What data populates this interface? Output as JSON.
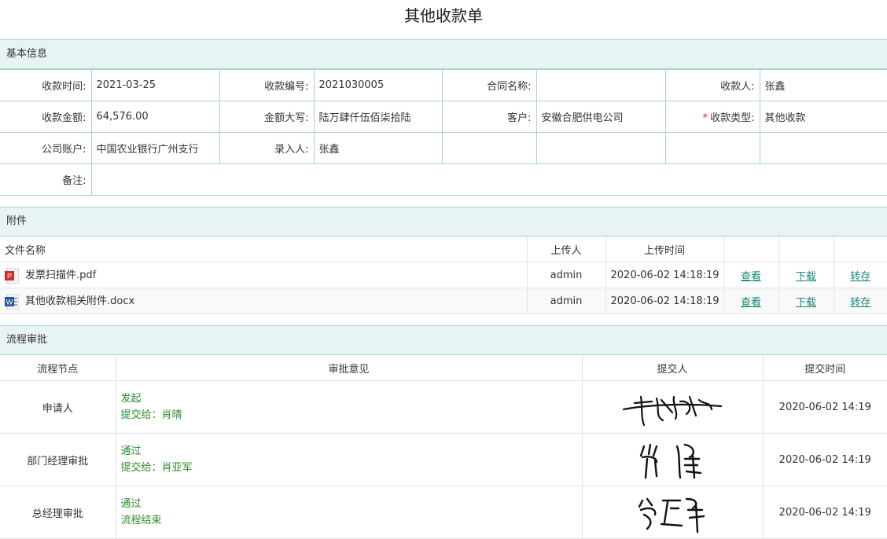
{
  "page": {
    "title": "其他收款单"
  },
  "basic": {
    "section_title": "基本信息",
    "receipt_time_label": "收款时间:",
    "receipt_time": "2021-03-25",
    "receipt_no_label": "收款编号:",
    "receipt_no": "2021030005",
    "contract_label": "合同名称:",
    "contract": "",
    "payee_label": "收款人:",
    "payee": "张鑫",
    "amount_label": "收款金额:",
    "amount": "64,576.00",
    "amount_upper_label": "金额大写:",
    "amount_upper": "陆万肆仟伍佰柒拾陆",
    "customer_label": "客户:",
    "customer": "安徽合肥供电公司",
    "type_required": "*",
    "type_label": "收款类型:",
    "type": "其他收款",
    "account_label": "公司账户:",
    "account": "中国农业银行广州支行",
    "entered_by_label": "录入人:",
    "entered_by": "张鑫",
    "remark_label": "备注:",
    "remark": ""
  },
  "attachments": {
    "section_title": "附件",
    "headers": {
      "name": "文件名称",
      "uploader": "上传人",
      "time": "上传时间"
    },
    "files": [
      {
        "icon": "pdf-file-icon",
        "name": "发票扫描件.pdf",
        "uploader": "admin",
        "time": "2020-06-02 14:18:19",
        "view": "查看",
        "download": "下载",
        "save": "转存"
      },
      {
        "icon": "word-file-icon",
        "name": "其他收款相关附件.docx",
        "uploader": "admin",
        "time": "2020-06-02 14:18:19",
        "view": "查看",
        "download": "下载",
        "save": "转存"
      }
    ]
  },
  "flow": {
    "section_title": "流程审批",
    "headers": {
      "node": "流程节点",
      "opinion": "审批意见",
      "submitter": "提交人",
      "time": "提交时间"
    },
    "steps": [
      {
        "node": "申请人",
        "line1": "发起",
        "line2": "提交给：肖晴",
        "signature": "handwritten-signature",
        "time": "2020-06-02 14:19"
      },
      {
        "node": "部门经理审批",
        "line1": "通过",
        "line2": "提交给：肖亚军",
        "signature": "handwritten-signature",
        "time": "2020-06-02 14:19"
      },
      {
        "node": "总经理审批",
        "line1": "通过",
        "line2": "流程结束",
        "signature": "handwritten-signature",
        "time": "2020-06-02 14:19"
      }
    ]
  },
  "colors": {
    "accent": "#1a8a7a",
    "section_bg": "#e8f4f3",
    "border": "#a9d2cf",
    "approve_text": "#2e8b2e",
    "required": "#e02020"
  }
}
